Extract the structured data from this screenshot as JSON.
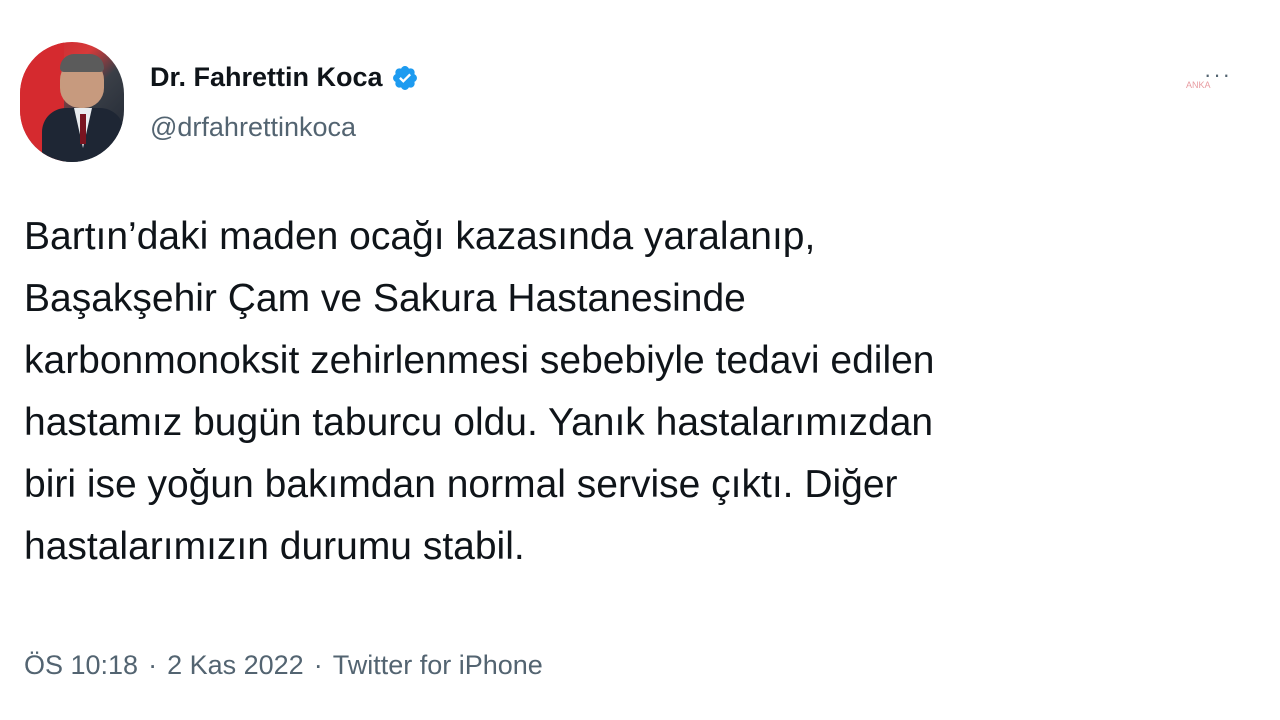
{
  "author": {
    "display_name": "Dr. Fahrettin Koca",
    "handle": "@drfahrettinkoca",
    "verified": true,
    "avatar_icon": "profile-photo"
  },
  "header": {
    "more_label": "···",
    "watermark": "ANKA"
  },
  "tweet": {
    "lines": [
      "Bartın’daki maden ocağı kazasında yaralanıp,",
      "Başakşehir Çam ve Sakura Hastanesinde",
      "karbonmonoksit zehirlenmesi sebebiyle tedavi edilen",
      "hastamız bugün taburcu oldu. Yanık hastalarımızdan",
      "biri ise yoğun bakımdan normal servise çıktı. Diğer",
      "hastalarımızın durumu stabil."
    ]
  },
  "meta": {
    "time": "ÖS 10:18",
    "separator": "·",
    "date": "2 Kas 2022",
    "source": "Twitter for iPhone"
  },
  "colors": {
    "verified": "#1d9bf0",
    "secondary_text": "#536471",
    "primary_text": "#0f1419"
  }
}
